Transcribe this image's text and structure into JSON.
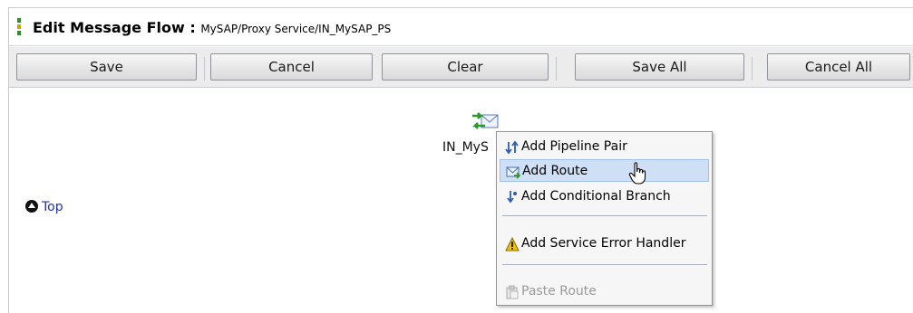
{
  "header": {
    "title": "Edit Message Flow",
    "separator": " : ",
    "path": "MySAP/Proxy Service/IN_MySAP_PS"
  },
  "toolbar": {
    "buttons": [
      {
        "label": "Save"
      },
      {
        "label": "Cancel"
      },
      {
        "label": "Clear"
      },
      {
        "label": "Save All"
      },
      {
        "label": "Cancel All"
      }
    ]
  },
  "canvas": {
    "top_link": "Top",
    "node_label": "IN_MyS"
  },
  "context_menu": {
    "items": [
      {
        "label": "Add Pipeline Pair",
        "icon": "pipeline-pair-icon"
      },
      {
        "label": "Add Route",
        "icon": "route-icon",
        "highlighted": true
      },
      {
        "label": "Add Conditional Branch",
        "icon": "conditional-branch-icon"
      },
      {
        "label": "Add Service Error Handler",
        "icon": "warning-icon"
      },
      {
        "label": "Paste Route",
        "icon": "paste-icon",
        "disabled": true
      }
    ]
  },
  "colors": {
    "toolbar_bg": "#ececec",
    "highlight": "#cfe0f6",
    "link": "#2233aa"
  }
}
